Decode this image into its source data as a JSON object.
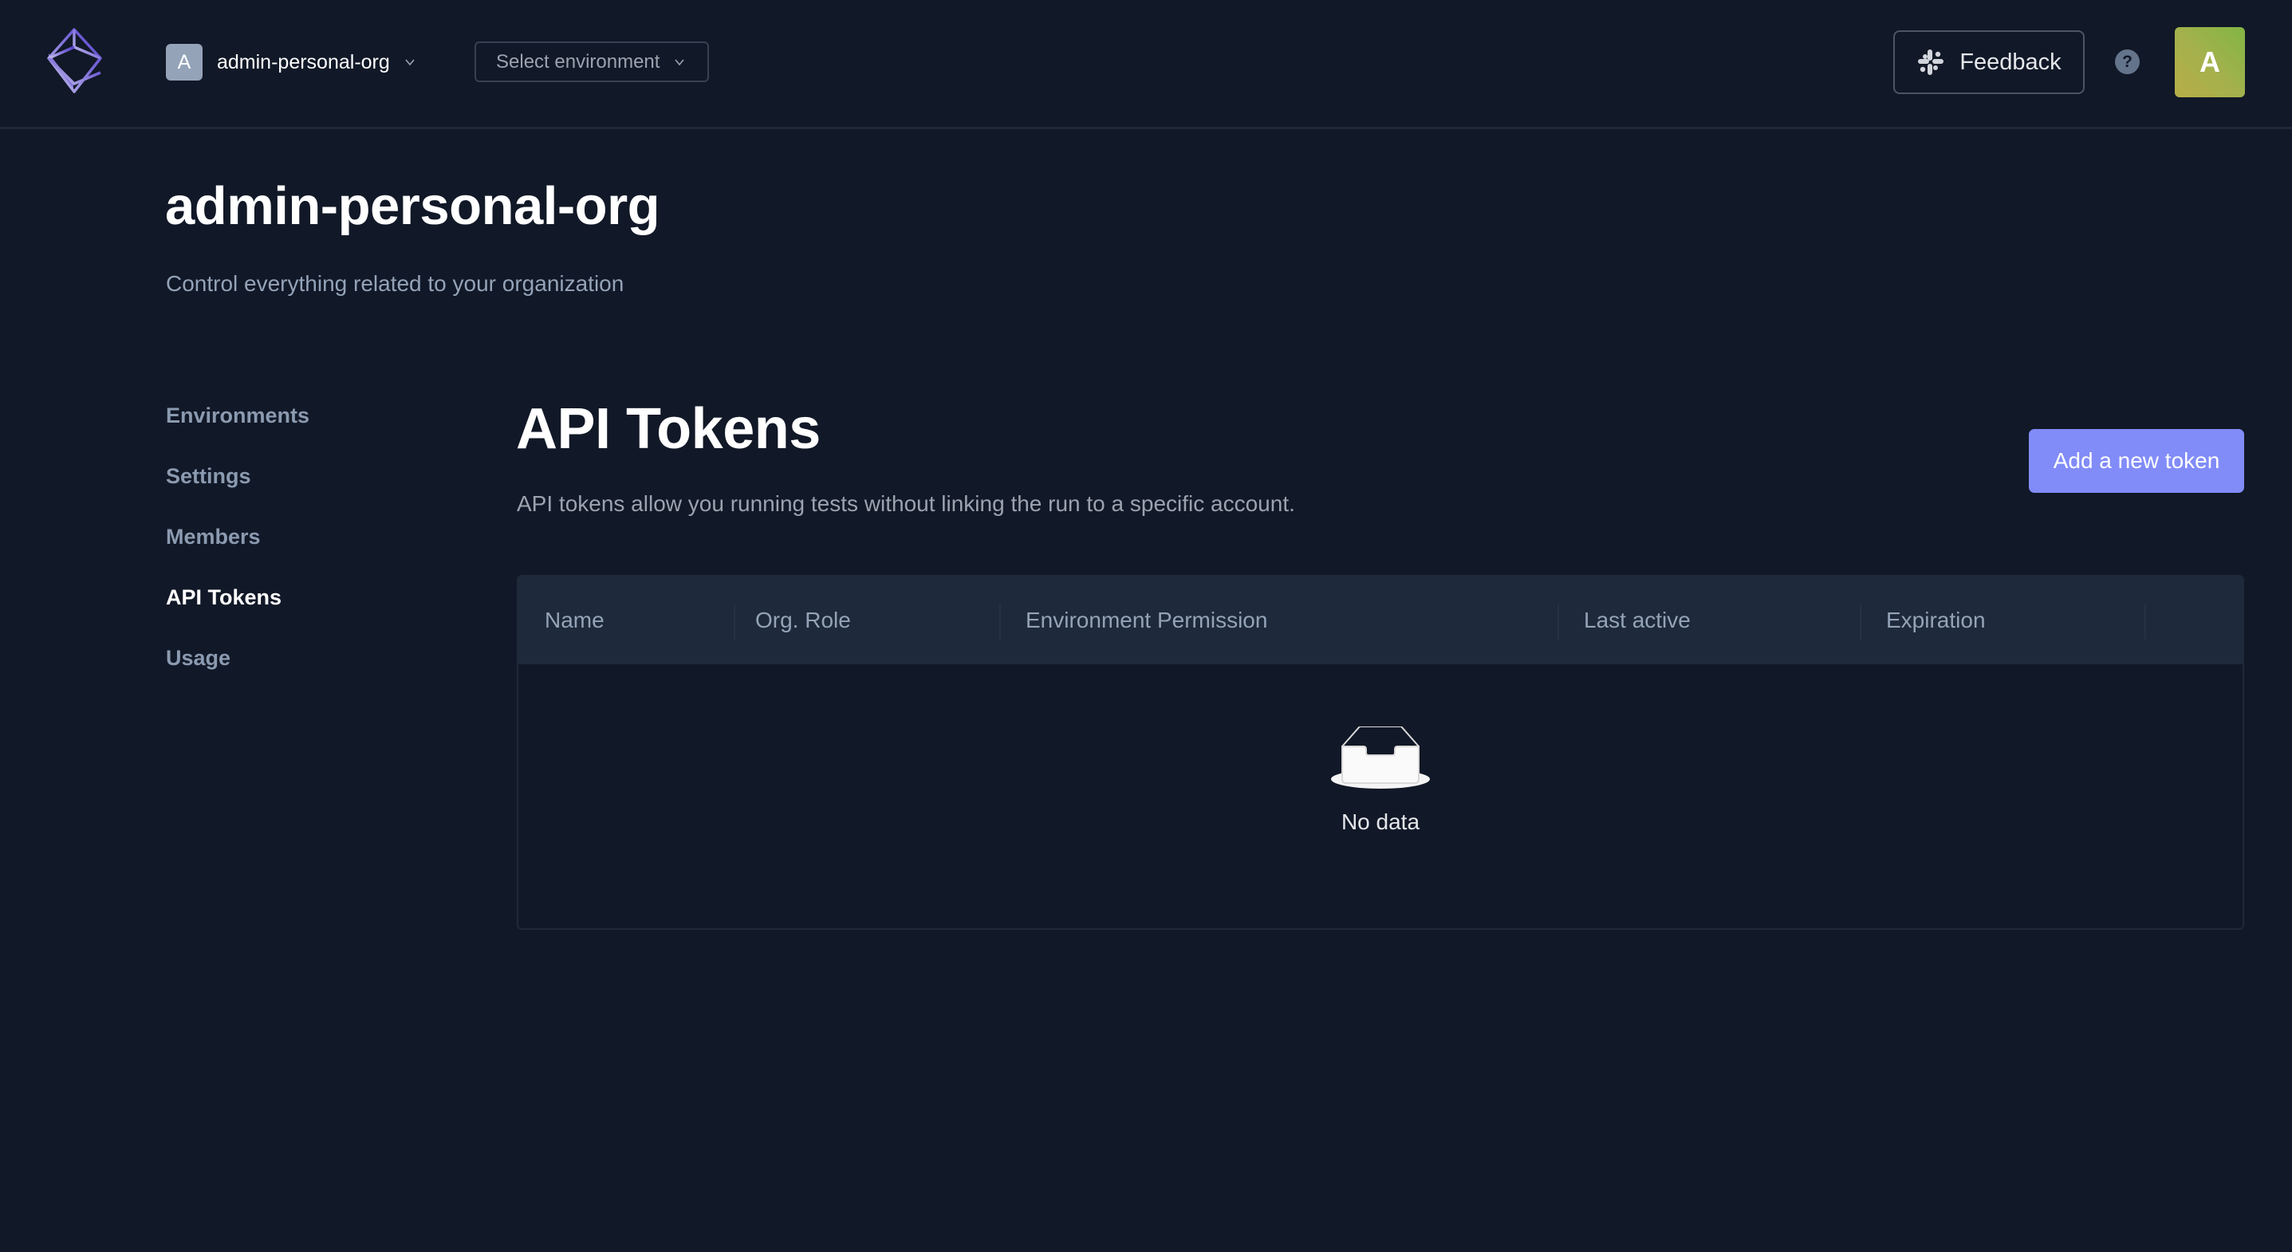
{
  "topbar": {
    "org": {
      "avatar_letter": "A",
      "name": "admin-personal-org"
    },
    "environment_select": {
      "placeholder": "Select environment"
    },
    "feedback_label": "Feedback",
    "help_label": "?",
    "user_avatar_letter": "A"
  },
  "page": {
    "title": "admin-personal-org",
    "subtitle": "Control everything related to your organization"
  },
  "sidebar": {
    "items": [
      {
        "label": "Environments",
        "active": false
      },
      {
        "label": "Settings",
        "active": false
      },
      {
        "label": "Members",
        "active": false
      },
      {
        "label": "API Tokens",
        "active": true
      },
      {
        "label": "Usage",
        "active": false
      }
    ]
  },
  "section": {
    "title": "API Tokens",
    "description": "API tokens allow you running tests without linking the run to a specific account.",
    "add_button_label": "Add a new token"
  },
  "table": {
    "columns": [
      "Name",
      "Org. Role",
      "Environment Permission",
      "Last active",
      "Expiration",
      ""
    ],
    "rows": [],
    "empty_text": "No data"
  },
  "colors": {
    "background": "#111827",
    "primary_button": "#818cf8",
    "table_header": "#1e293b",
    "muted_text": "#94a3b8",
    "brand": "#5b47d6"
  }
}
